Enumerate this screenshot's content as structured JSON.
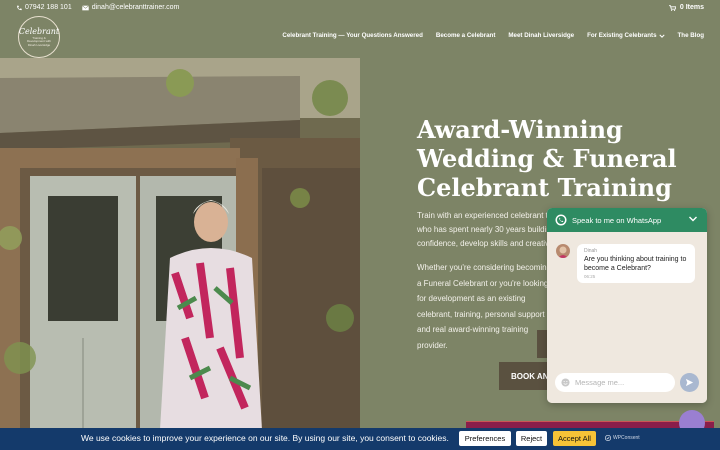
{
  "topbar": {
    "phone": "07942 188 101",
    "email": "dinah@celebranttrainer.com",
    "cart": "0 Items"
  },
  "logo": {
    "script": "Celebrant",
    "tagline": "Training & Development with Dinah Liversidge"
  },
  "nav": {
    "items": [
      "Celebrant Training — Your Questions Answered",
      "Become a Celebrant",
      "Meet Dinah Liversidge",
      "For Existing Celebrants",
      "The Blog"
    ]
  },
  "hero": {
    "title_lines": [
      "Award-Winning",
      "Wedding & Funeral",
      "Celebrant Training"
    ],
    "p1": "Train with an experienced celebrant trainer who has spent nearly 30 years building confidence, develop skills and creativity",
    "p2": "Whether you're considering becoming a Funeral Celebrant or you're looking for development as an existing celebrant, training, personal support and real award-winning training provider.",
    "book_label": "BOOK AN I"
  },
  "whatsapp": {
    "header": "Speak to me on WhatsApp",
    "sender": "Dinah",
    "message": "Are you thinking about training to become a Celebrant?",
    "time": "06:25",
    "placeholder": "Message me..."
  },
  "cookie": {
    "text": "We use cookies to improve your experience on our site. By using our site, you consent to cookies.",
    "preferences": "Preferences",
    "reject": "Reject",
    "accept": "Accept All",
    "brand": "WPConsent"
  },
  "colors": {
    "olive": "#7d8466",
    "whatsapp_green": "#2e8b62",
    "cookie_bar": "#143a6b",
    "accept": "#f6c337"
  }
}
